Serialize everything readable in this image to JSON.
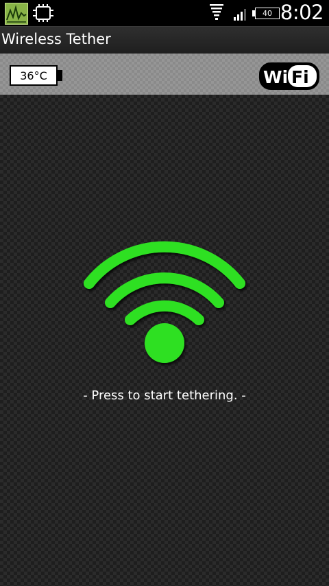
{
  "status_bar": {
    "time": "8:02",
    "battery_level": "40",
    "icons": [
      "app-notification-icon",
      "chip-icon",
      "wifi-signal-icon",
      "cell-signal-icon",
      "battery-icon"
    ]
  },
  "title_bar": {
    "title": "Wireless Tether"
  },
  "top_panel": {
    "temperature": "36°C",
    "logo_left": "Wi",
    "logo_right": "Fi"
  },
  "main": {
    "hint": "- Press to start tethering. -",
    "icon": "wifi-icon"
  },
  "colors": {
    "accent": "#2fe024",
    "background": "#2b2b2b"
  }
}
